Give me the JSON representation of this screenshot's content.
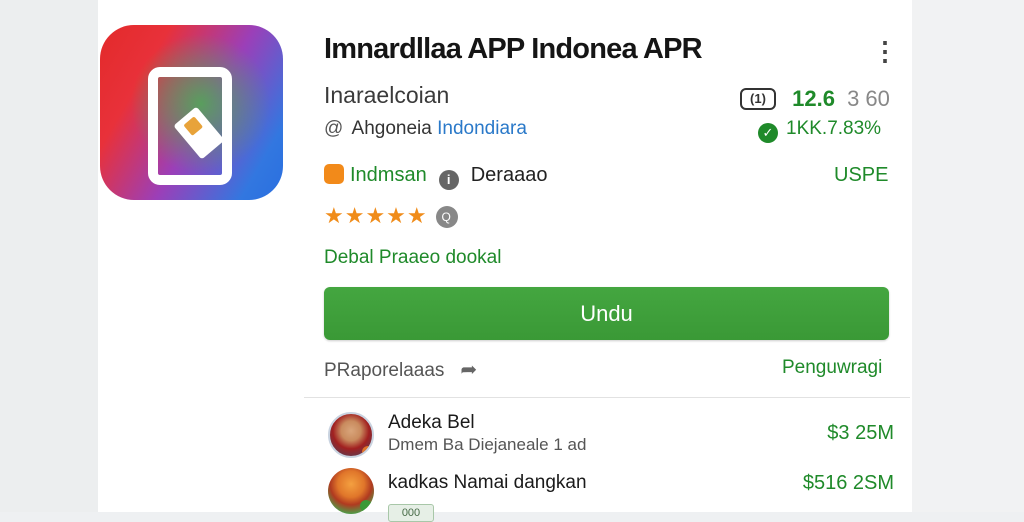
{
  "app": {
    "title": "Imnardllaa APP Indonea APR",
    "developer": "Inaraelcoian",
    "location_prefix": "Ahgoneia",
    "location_link": "Indondiara",
    "version_icon_label": "(1)",
    "version_number": "12.6",
    "version_sub": "3 60",
    "rating_pct": "1KK.7.83%",
    "category": "Indmsan",
    "dev_name": "Deraaao",
    "usps": "USPE",
    "stars": "★★★★★",
    "badge_icon_label": "Q",
    "detail_link": "Debal Praaeo dookal",
    "download_label": "Undu",
    "share_label": "PRaporelaaas",
    "pengu_label": "Penguwragi",
    "menu_icon_label": "⋮",
    "share_icon_label": "➦"
  },
  "list": [
    {
      "name": "Adeka Bel",
      "sub": "Dmem Ba Diejaneale 1 ad",
      "price": "$3 25M"
    },
    {
      "name": "kadkas Namai dangkan",
      "badge": "000",
      "price": "$516 2SM"
    }
  ],
  "icons": {
    "app_icon": "app-logo-icon",
    "menu": "more-vert-icon",
    "version": "version-icon",
    "check": "check-circle-icon",
    "category": "category-icon",
    "info": "info-icon",
    "badge": "badge-icon",
    "share": "share-icon",
    "dollar": "dollar-icon"
  },
  "colors": {
    "accent_green": "#1f8a2a",
    "button_green": "#44a640",
    "link_blue": "#2a79c9",
    "star_orange": "#f08c1a"
  }
}
